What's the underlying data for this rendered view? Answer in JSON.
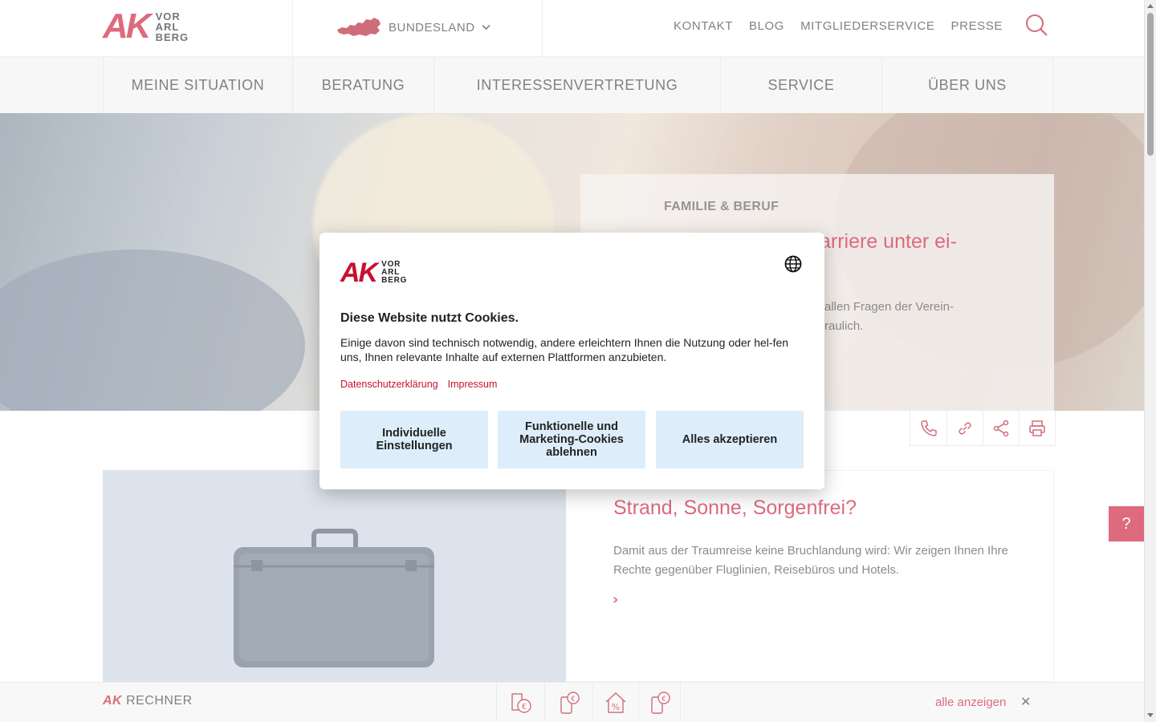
{
  "header": {
    "logo": {
      "mark": "AK",
      "lines": [
        "VOR",
        "ARL",
        "BERG"
      ]
    },
    "bundesland_label": "BUNDESLAND",
    "top_links": [
      "KONTAKT",
      "BLOG",
      "MITGLIEDERSERVICE",
      "PRESSE"
    ]
  },
  "nav": {
    "items": [
      "MEINE SITUATION",
      "BERATUNG",
      "INTERESSENVERTRETUNG",
      "SERVICE",
      "ÜBER UNS"
    ]
  },
  "hero": {
    "kicker": "FAMILIE & BERUF",
    "headline_visible": "arriere unter ei-",
    "teaser_line1": "allen Fragen der Verein-",
    "teaser_line2": "raulich."
  },
  "teaser": {
    "title": "Strand, Sonne, Sorgenfrei?",
    "text": "Damit aus der Traumreise keine Bruchlandung wird: Wir zeigen Ihnen Ihre Rechte gegenüber Fluglinien, Reisebüros und Hotels.",
    "arrow": "›"
  },
  "help_label": "?",
  "rechner": {
    "prefix": "AK",
    "label": "RECHNER",
    "all_link": "alle anzeigen",
    "close": "✕"
  },
  "cookie_dialog": {
    "logo": {
      "mark": "AK",
      "lines": [
        "VOR",
        "ARL",
        "BERG"
      ]
    },
    "title": "Diese Website nutzt Cookies.",
    "text": "Einige davon sind technisch notwendig, andere erleichtern Ihnen die Nutzung oder hel-fen uns, Ihnen relevante Inhalte auf externen Plattformen anzubieten.",
    "links": [
      "Datenschutzerklärung",
      "Impressum"
    ],
    "buttons": [
      "Individuelle Einstellungen",
      "Funktionelle und Marketing-Cookies ablehnen",
      "Alles akzeptieren"
    ]
  },
  "colors": {
    "brand_red": "#c8102e",
    "button_bg": "#ddeefa",
    "nav_bg": "#f2f2f2"
  },
  "icons": {
    "tools": [
      "phone-icon",
      "link-icon",
      "share-icon",
      "print-icon"
    ],
    "rechner": [
      "coins-calculator-icon",
      "phone-euro-icon",
      "house-percent-icon",
      "phone-euro-icon-2"
    ]
  }
}
